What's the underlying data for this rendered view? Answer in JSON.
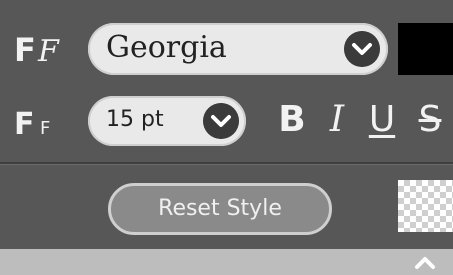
{
  "font_family": {
    "value": "Georgia",
    "icon": "font-family-icon"
  },
  "font_size": {
    "value": "15 pt",
    "icon": "font-size-icon"
  },
  "text_styles": {
    "bold": "B",
    "italic": "I",
    "underline": "U",
    "strikethrough": "S"
  },
  "colors": {
    "text_color": "#000000",
    "background": "transparent",
    "panel": "#575757"
  },
  "reset_label": "Reset Style"
}
